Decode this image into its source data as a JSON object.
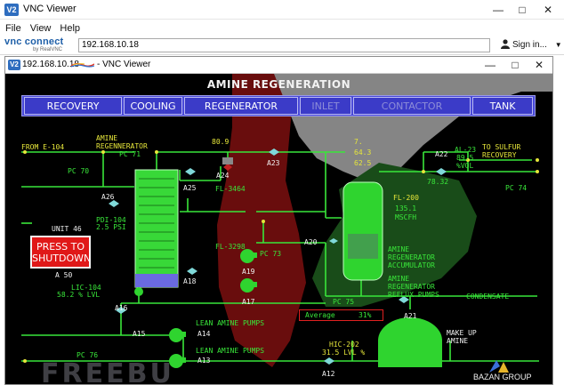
{
  "outer_window": {
    "title": "VNC Viewer",
    "icon_text": "V2",
    "controls": [
      "minimize-icon",
      "maximize-icon",
      "close-icon"
    ]
  },
  "menu": [
    "File",
    "View",
    "Help"
  ],
  "toolbar": {
    "logo_line1": "vnc connect",
    "logo_line2": "by RealVNC",
    "address": "192.168.10.18",
    "signin": "Sign in..."
  },
  "inner_window": {
    "title_ip": "192.168.10.18",
    "title_app": "- VNC Viewer",
    "icon_text": "V2"
  },
  "scada": {
    "screen_title": "AMINE REGENERATION",
    "tabs": [
      {
        "label": "RECOVERY",
        "active": true
      },
      {
        "label": "COOLING",
        "active": true
      },
      {
        "label": "REGENERATOR",
        "active": true
      },
      {
        "label": "INLET",
        "active": false
      },
      {
        "label": "CONTACTOR",
        "active": false
      },
      {
        "label": "TANK",
        "active": true
      }
    ],
    "labels": {
      "from_e104": "FROM E-104",
      "amine_regenerator": "AMINE\nREGENNERATOR",
      "pc71": "PC 71",
      "pc70": "PC 70",
      "a26": "A26",
      "pdi104": "PDI-104",
      "pdi104_val": "2.5 PSI",
      "unit46": "UNIT 46",
      "a50": "A 50",
      "lic104": "LIC-104",
      "lic104_val": "58.2 % LVL",
      "a16": "A16",
      "a15": "A15",
      "pc76": "PC 76",
      "a25": "A25",
      "a24": "A24",
      "val_809": "80.9",
      "fl3464": "FL-3464",
      "a23": "A23",
      "a18": "A18",
      "fl3298": "FL-3298",
      "pc73": "PC 73",
      "a19": "A19",
      "a17": "A17",
      "lean_pumps_1": "LEAN AMINE PUMPS",
      "a14": "A14",
      "lean_pumps_2": "LEAN AMINE PUMPS",
      "a13": "A13",
      "val_7": "7.",
      "val_643": "64.3",
      "val_625": "62.5",
      "a22": "A22",
      "al23": "AL-23",
      "al23_val": "89.5",
      "al23_unit": "%VOL",
      "val_7832": "78.32",
      "to_sulfur": "TO SULFUR\nRECOVERY",
      "pc74": "PC 74",
      "fl200": "FL-200",
      "fl200_val": "135.1",
      "fl200_unit": "MSCFH",
      "a20": "A20",
      "accumulator": "AMINE\nREGENERATOR\nACCUMULATOR",
      "reflux": "AMINE\nREGENERATOR\nREFLUX PUMPS",
      "condensate": "CONDENSATE",
      "pc75": "PC 75",
      "a21": "A21",
      "average_label": "Average",
      "average_val": "31%",
      "make_up": "MAKE UP\nAMINE",
      "hic202": "HIC-202",
      "hic202_val": "31.5 LVL %",
      "a12": "A12"
    },
    "shutdown_label": "PRESS TO\nSHUTDOWN",
    "brand": "BAZAN GROUP",
    "watermark": "FREEBU"
  },
  "colors": {
    "pipe": "#39e63a",
    "tab_bg": "#3b3bc8",
    "alarm": "#e01818",
    "tank": "#2fd42f",
    "column": "#38d838",
    "column_bottom": "#6a6ae0",
    "text_yellow": "#e6e63a"
  }
}
